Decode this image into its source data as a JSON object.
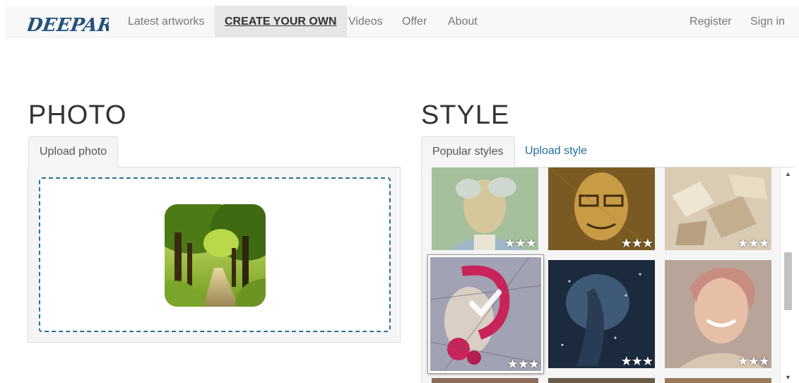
{
  "nav": {
    "logo_text": "DEEPART.io",
    "items": [
      {
        "label": "Latest artworks",
        "active": false
      },
      {
        "label": "CREATE YOUR OWN",
        "active": true
      },
      {
        "label": "Videos",
        "active": false
      },
      {
        "label": "Offer",
        "active": false
      },
      {
        "label": "About",
        "active": false
      }
    ],
    "register_label": "Register",
    "signin_label": "Sign in"
  },
  "photo": {
    "heading": "PHOTO",
    "tab_upload": "Upload photo"
  },
  "style": {
    "heading": "STYLE",
    "tab_popular": "Popular styles",
    "tab_upload": "Upload style",
    "tiles": [
      {
        "stars": "★★★",
        "selected": false
      },
      {
        "stars": "★★★",
        "selected": false
      },
      {
        "stars": "★★★",
        "selected": false
      },
      {
        "stars": "★★★",
        "selected": true
      },
      {
        "stars": "★★★",
        "selected": false
      },
      {
        "stars": "★★★",
        "selected": false
      }
    ]
  },
  "colors": {
    "nav_bg": "#f8f8f8",
    "active_tab_bg": "#e7e7e7",
    "link_blue": "#1e6da0",
    "dropzone_border": "#2a6f9b"
  }
}
